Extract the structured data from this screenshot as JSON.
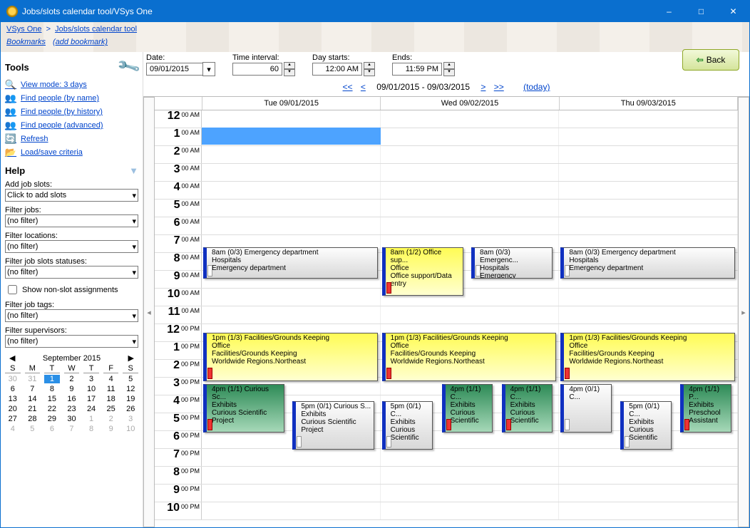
{
  "window": {
    "title": "Jobs/slots calendar tool/VSys One"
  },
  "breadcrumb": {
    "root": "VSys One",
    "sep": ">",
    "leaf": "Jobs/slots calendar tool"
  },
  "bookmarks": {
    "label": "Bookmarks",
    "add": "(add bookmark)"
  },
  "back_label": "Back",
  "sidebar": {
    "tools_hdr": "Tools",
    "help_hdr": "Help",
    "tools": [
      {
        "label": "View mode: 3 days"
      },
      {
        "label": "Find people (by name)"
      },
      {
        "label": "Find people (by history)"
      },
      {
        "label": "Find people (advanced)"
      },
      {
        "label": "Refresh"
      },
      {
        "label": "Load/save criteria"
      }
    ],
    "add_slots_lbl": "Add job slots:",
    "add_slots_val": "Click to add slots",
    "filter_jobs_lbl": "Filter jobs:",
    "filter_jobs_val": "(no filter)",
    "filter_loc_lbl": "Filter locations:",
    "filter_loc_val": "(no filter)",
    "filter_status_lbl": "Filter job slots statuses:",
    "filter_status_val": "(no filter)",
    "show_nonslot": "Show non-slot assignments",
    "filter_tags_lbl": "Filter job tags:",
    "filter_tags_val": "(no filter)",
    "filter_sup_lbl": "Filter supervisors:",
    "filter_sup_val": "(no filter)"
  },
  "minical": {
    "title": "September 2015",
    "dow": [
      "S",
      "M",
      "T",
      "W",
      "T",
      "F",
      "S"
    ],
    "cells": [
      {
        "n": "30",
        "dim": true
      },
      {
        "n": "31",
        "dim": true
      },
      {
        "n": "1",
        "sel": true
      },
      {
        "n": "2"
      },
      {
        "n": "3"
      },
      {
        "n": "4"
      },
      {
        "n": "5"
      },
      {
        "n": "6"
      },
      {
        "n": "7"
      },
      {
        "n": "8"
      },
      {
        "n": "9"
      },
      {
        "n": "10"
      },
      {
        "n": "11"
      },
      {
        "n": "12"
      },
      {
        "n": "13"
      },
      {
        "n": "14"
      },
      {
        "n": "15"
      },
      {
        "n": "16"
      },
      {
        "n": "17"
      },
      {
        "n": "18"
      },
      {
        "n": "19"
      },
      {
        "n": "20"
      },
      {
        "n": "21"
      },
      {
        "n": "22"
      },
      {
        "n": "23"
      },
      {
        "n": "24"
      },
      {
        "n": "25"
      },
      {
        "n": "26"
      },
      {
        "n": "27"
      },
      {
        "n": "28"
      },
      {
        "n": "29"
      },
      {
        "n": "30"
      },
      {
        "n": "1",
        "dim": true
      },
      {
        "n": "2",
        "dim": true
      },
      {
        "n": "3",
        "dim": true
      },
      {
        "n": "4",
        "dim": true
      },
      {
        "n": "5",
        "dim": true
      },
      {
        "n": "6",
        "dim": true
      },
      {
        "n": "7",
        "dim": true
      },
      {
        "n": "8",
        "dim": true
      },
      {
        "n": "9",
        "dim": true
      },
      {
        "n": "10",
        "dim": true
      }
    ]
  },
  "controls": {
    "date_lbl": "Date:",
    "date_val": "09/01/2015",
    "int_lbl": "Time interval:",
    "int_val": "60",
    "start_lbl": "Day starts:",
    "start_val": "12:00 AM",
    "end_lbl": "Ends:",
    "end_val": "11:59 PM"
  },
  "navline": {
    "first": "<<",
    "prev": "<",
    "range": "09/01/2015 - 09/03/2015",
    "next": ">",
    "last": ">>",
    "today": "(today)"
  },
  "days": [
    "Tue 09/01/2015",
    "Wed 09/02/2015",
    "Thu 09/03/2015"
  ],
  "hours": [
    {
      "h": "12",
      "ap": "00 AM"
    },
    {
      "h": "1",
      "ap": "00 AM"
    },
    {
      "h": "2",
      "ap": "00 AM"
    },
    {
      "h": "3",
      "ap": "00 AM"
    },
    {
      "h": "4",
      "ap": "00 AM"
    },
    {
      "h": "5",
      "ap": "00 AM"
    },
    {
      "h": "6",
      "ap": "00 AM"
    },
    {
      "h": "7",
      "ap": "00 AM"
    },
    {
      "h": "8",
      "ap": "00 AM"
    },
    {
      "h": "9",
      "ap": "00 AM"
    },
    {
      "h": "10",
      "ap": "00 AM"
    },
    {
      "h": "11",
      "ap": "00 AM"
    },
    {
      "h": "12",
      "ap": "00 PM"
    },
    {
      "h": "1",
      "ap": "00 PM"
    },
    {
      "h": "2",
      "ap": "00 PM"
    },
    {
      "h": "3",
      "ap": "00 PM"
    },
    {
      "h": "4",
      "ap": "00 PM"
    },
    {
      "h": "5",
      "ap": "00 PM"
    },
    {
      "h": "6",
      "ap": "00 PM"
    },
    {
      "h": "7",
      "ap": "00 PM"
    },
    {
      "h": "8",
      "ap": "00 PM"
    },
    {
      "h": "9",
      "ap": "00 PM"
    },
    {
      "h": "10",
      "ap": "00 PM"
    }
  ],
  "events": [
    {
      "day": 0,
      "row": 8,
      "span": 2,
      "half": "L",
      "cls": "gray blue",
      "ind": "white",
      "hdr": "8am (0/3) Emergency department",
      "l1": "Hospitals",
      "l2": "Emergency department"
    },
    {
      "day": 1,
      "row": 8,
      "span": 3,
      "half": "LN",
      "cls": "yellow blue",
      "ind": "red",
      "hdr": "8am (1/2) Office sup...",
      "l1": "Office",
      "l2": "Office support/Data entry"
    },
    {
      "day": 1,
      "row": 8,
      "span": 2,
      "half": "RN",
      "cls": "gray blue",
      "ind": "white",
      "hdr": "8am (0/3) Emergenc...",
      "l1": "Hospitals",
      "l2": "Emergency"
    },
    {
      "day": 2,
      "row": 8,
      "span": 2,
      "half": "L",
      "cls": "gray blue",
      "ind": "white",
      "hdr": "8am (0/3) Emergency department",
      "l1": "Hospitals",
      "l2": "Emergency department"
    },
    {
      "day": 0,
      "row": 13,
      "span": 3,
      "half": "L",
      "cls": "yellow blue",
      "ind": "red",
      "hdr": "1pm (1/3) Facilities/Grounds Keeping",
      "l1": "Office",
      "l2": "Facilities/Grounds Keeping",
      "l3": "Worldwide Regions.Northeast"
    },
    {
      "day": 1,
      "row": 13,
      "span": 3,
      "half": "L",
      "cls": "yellow blue",
      "ind": "red",
      "hdr": "1pm (1/3) Facilities/Grounds Keeping",
      "l1": "Office",
      "l2": "Facilities/Grounds Keeping",
      "l3": "Worldwide Regions.Northeast"
    },
    {
      "day": 2,
      "row": 13,
      "span": 3,
      "half": "L",
      "cls": "yellow blue",
      "ind": "red",
      "hdr": "1pm (1/3) Facilities/Grounds Keeping",
      "l1": "Office",
      "l2": "Facilities/Grounds Keeping",
      "l3": "Worldwide Regions.Northeast"
    },
    {
      "day": 0,
      "row": 16,
      "span": 3,
      "half": "LN",
      "cls": "green blue",
      "ind": "red",
      "hdr": "4pm (1/1) Curious Sc...",
      "l1": "Exhibits",
      "l2": "Curious Scientific Project"
    },
    {
      "day": 0,
      "row": 17,
      "span": 3,
      "half": "RN",
      "cls": "gray blue",
      "ind": "white",
      "hdr": "5pm (0/1) Curious S...",
      "l1": "Exhibits",
      "l2": "Curious Scientific Project"
    },
    {
      "day": 1,
      "row": 17,
      "span": 3,
      "half": "LN3",
      "cls": "gray blue",
      "ind": "white",
      "hdr": "5pm (0/1) C...",
      "l1": "Exhibits",
      "l2": "Curious",
      "l3": "Scientific"
    },
    {
      "day": 1,
      "row": 16,
      "span": 3,
      "half": "MN3",
      "cls": "green blue",
      "ind": "red",
      "hdr": "4pm (1/1) C...",
      "l1": "Exhibits",
      "l2": "Curious",
      "l3": "Scientific"
    },
    {
      "day": 1,
      "row": 16,
      "span": 3,
      "half": "RN3",
      "cls": "green blue",
      "ind": "red",
      "hdr": "4pm (1/1) C...",
      "l1": "Exhibits",
      "l2": "Curious",
      "l3": "Scientific"
    },
    {
      "day": 2,
      "row": 16,
      "span": 3,
      "half": "LN3",
      "cls": "gray blue",
      "ind": "white",
      "hdr": "4pm (0/1) C...",
      "l1": ""
    },
    {
      "day": 2,
      "row": 17,
      "span": 3,
      "half": "MN3",
      "cls": "gray blue",
      "ind": "white",
      "hdr": "5pm (0/1) C...",
      "l1": "Exhibits",
      "l2": "Curious",
      "l3": "Scientific"
    },
    {
      "day": 2,
      "row": 16,
      "span": 3,
      "half": "RN3",
      "cls": "green blue",
      "ind": "red",
      "hdr": "4pm (1/1) P...",
      "l1": "Exhibits",
      "l2": "Preschool",
      "l3": "Assistant"
    }
  ]
}
